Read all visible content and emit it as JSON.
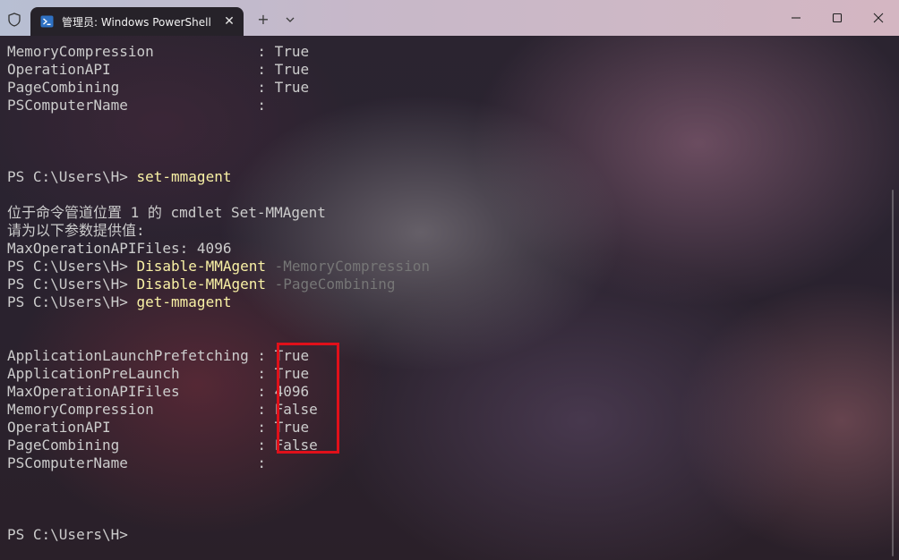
{
  "window": {
    "tab_title": "管理员: Windows PowerShell",
    "tab_close_glyph": "✕",
    "new_tab_glyph": "+",
    "icons": {
      "security": "shield-icon",
      "app": "powershell-icon",
      "dropdown": "chevron-down-icon",
      "minimize": "minimize-icon",
      "maximize": "maximize-icon",
      "close": "close-icon"
    }
  },
  "terminal": {
    "colors": {
      "text": "#cccccc",
      "command": "#f9f1a5",
      "parameter": "#767676",
      "highlight_border": "#e0101a"
    },
    "lines": [
      {
        "plain": "MemoryCompression            : True"
      },
      {
        "plain": "OperationAPI                 : True"
      },
      {
        "plain": "PageCombining                : True"
      },
      {
        "plain": "PSComputerName               :"
      },
      {
        "prompt": "PS C:\\Users\\H> ",
        "command": "set-mmagent"
      },
      {
        "plain": "位于命令管道位置 1 的 cmdlet Set-MMAgent"
      },
      {
        "plain": "请为以下参数提供值:"
      },
      {
        "plain": "MaxOperationAPIFiles: 4096"
      },
      {
        "prompt": "PS C:\\Users\\H> ",
        "command": "Disable-MMAgent",
        "param": " -MemoryCompression"
      },
      {
        "prompt": "PS C:\\Users\\H> ",
        "command": "Disable-MMAgent",
        "param": " -PageCombining"
      },
      {
        "prompt": "PS C:\\Users\\H> ",
        "command": "get-mmagent"
      },
      {
        "plain": "ApplicationLaunchPrefetching : True"
      },
      {
        "plain": "ApplicationPreLaunch         : True"
      },
      {
        "plain": "MaxOperationAPIFiles         : 4096"
      },
      {
        "plain": "MemoryCompression            : False"
      },
      {
        "plain": "OperationAPI                 : True"
      },
      {
        "plain": "PageCombining                : False"
      },
      {
        "plain": "PSComputerName               :"
      },
      {
        "prompt": "PS C:\\Users\\H>"
      }
    ]
  }
}
